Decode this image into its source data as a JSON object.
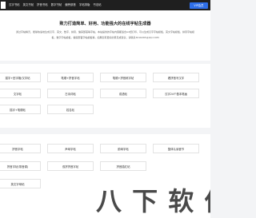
{
  "header": {
    "nav": [
      "汉字书帖",
      "英文书帖",
      "拼音书帖",
      "数字书帖",
      "偏旁部首",
      "字帖排版",
      "书法帖"
    ],
    "vip_label": "VIP会员"
  },
  "hero": {
    "title": "致力打造简单、好用、功能强大的在线字帖生成器",
    "desc": "通过字帖精灵，能够快速地生成汉字、英文、数字、拼音、偏旁部首等字帖，本站提供的字帖内容都适合A4纸打印，可以生成汉字字帖模板，英文字帖模板，拼音字帖模板，数字字帖模板，偏旁部首字帖模板等，如果您有更好的意见或建议，请联系3016265@QQ.COM"
  },
  "section1": {
    "rows": [
      [
        "描字+田字格/汉字帖",
        "笔顺+拼音字帖",
        "笔顺+拼音练字帖",
        "看拼音写汉字"
      ],
      [
        "文字帖",
        "古诗词帖",
        "成语帖",
        "汉字24个基本笔画"
      ],
      [
        "描字+笔顺帖",
        "姓名帖",
        "",
        ""
      ]
    ]
  },
  "section2": {
    "rows": [
      [
        "拼音字帖",
        "声母字帖",
        "韵母字帖",
        "整体认读音节"
      ],
      [
        "拼音字帖(带音调)",
        "双拼拼音字帖",
        "拼音描红帖",
        ""
      ],
      [
        "英文字母帖",
        "",
        "",
        "",
        ""
      ]
    ]
  },
  "watermark": {
    "text": "八 下 软 件",
    "sub": "www.xz7.com"
  }
}
